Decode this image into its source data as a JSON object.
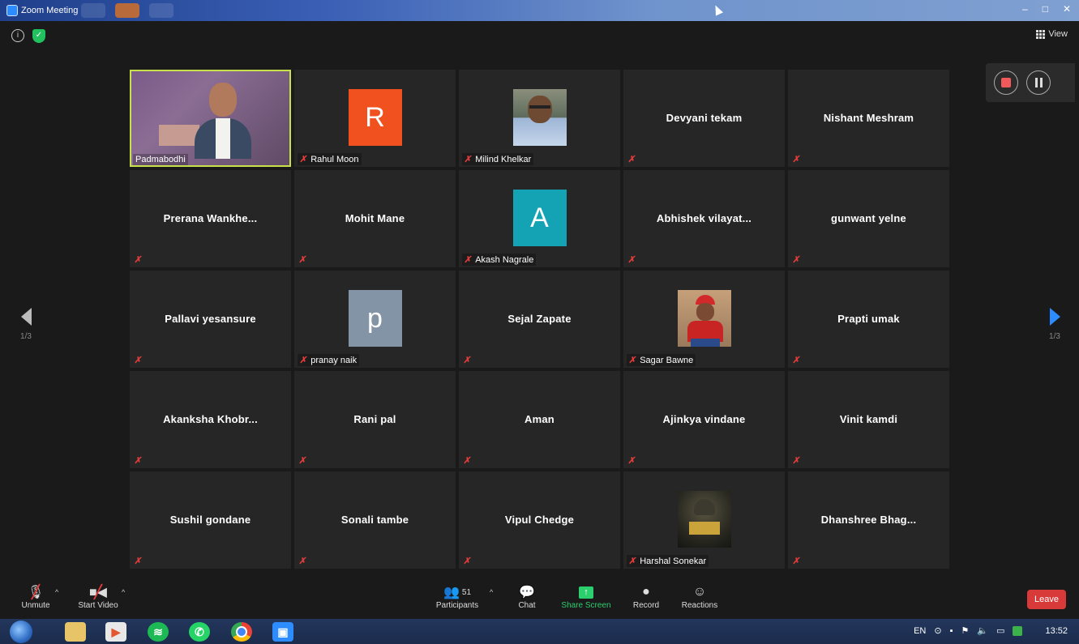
{
  "window": {
    "title": "Zoom Meeting"
  },
  "top": {
    "view_label": "View"
  },
  "pagination": {
    "left": "1/3",
    "right": "1/3"
  },
  "tiles": [
    {
      "name": "Padmabodhi",
      "type": "video",
      "muted": false,
      "active": true
    },
    {
      "name": "Rahul Moon",
      "type": "avatar",
      "initial": "R",
      "color": "#f0511f",
      "muted": true
    },
    {
      "name": "Milind Khelkar",
      "type": "photo",
      "muted": true
    },
    {
      "name": "Devyani tekam",
      "type": "name",
      "muted": true
    },
    {
      "name": "Nishant Meshram",
      "type": "name",
      "muted": true
    },
    {
      "name": "Prerana  Wankhe...",
      "type": "name",
      "muted": true
    },
    {
      "name": "Mohit Mane",
      "type": "name",
      "muted": true
    },
    {
      "name": "Akash Nagrale",
      "type": "avatar",
      "initial": "A",
      "color": "#13a3b5",
      "muted": true
    },
    {
      "name": "Abhishek  vilayat...",
      "type": "name",
      "muted": true
    },
    {
      "name": "gunwant yelne",
      "type": "name",
      "muted": true
    },
    {
      "name": "Pallavi yesansure",
      "type": "name",
      "muted": true
    },
    {
      "name": "pranay naik",
      "type": "avatar",
      "initial": "p",
      "color": "#8294a5",
      "muted": true
    },
    {
      "name": "Sejal Zapate",
      "type": "name",
      "muted": true
    },
    {
      "name": "Sagar Bawne",
      "type": "photo",
      "muted": true
    },
    {
      "name": "Prapti umak",
      "type": "name",
      "muted": true
    },
    {
      "name": "Akanksha  Khobr...",
      "type": "name",
      "muted": true
    },
    {
      "name": "Rani pal",
      "type": "name",
      "muted": true
    },
    {
      "name": "Aman",
      "type": "name",
      "muted": true
    },
    {
      "name": "Ajinkya vindane",
      "type": "name",
      "muted": true
    },
    {
      "name": "Vinit kamdi",
      "type": "name",
      "muted": true
    },
    {
      "name": "Sushil gondane",
      "type": "name",
      "muted": true
    },
    {
      "name": "Sonali tambe",
      "type": "name",
      "muted": true
    },
    {
      "name": "Vipul Chedge",
      "type": "name",
      "muted": true
    },
    {
      "name": "Harshal Sonekar",
      "type": "photo",
      "muted": true
    },
    {
      "name": "Dhanshree  Bhag...",
      "type": "name",
      "muted": true
    }
  ],
  "toolbar": {
    "unmute": "Unmute",
    "start_video": "Start Video",
    "participants": "Participants",
    "participants_count": "51",
    "chat": "Chat",
    "share_screen": "Share Screen",
    "record": "Record",
    "reactions": "Reactions",
    "leave": "Leave"
  },
  "taskbar": {
    "lang": "EN",
    "time": "13:52"
  },
  "colors": {
    "active_border": "#c8e04a",
    "leave": "#d83a3a",
    "share": "#2ccf6d",
    "muted_icon": "#e23b3b",
    "accent": "#2d8cff"
  }
}
